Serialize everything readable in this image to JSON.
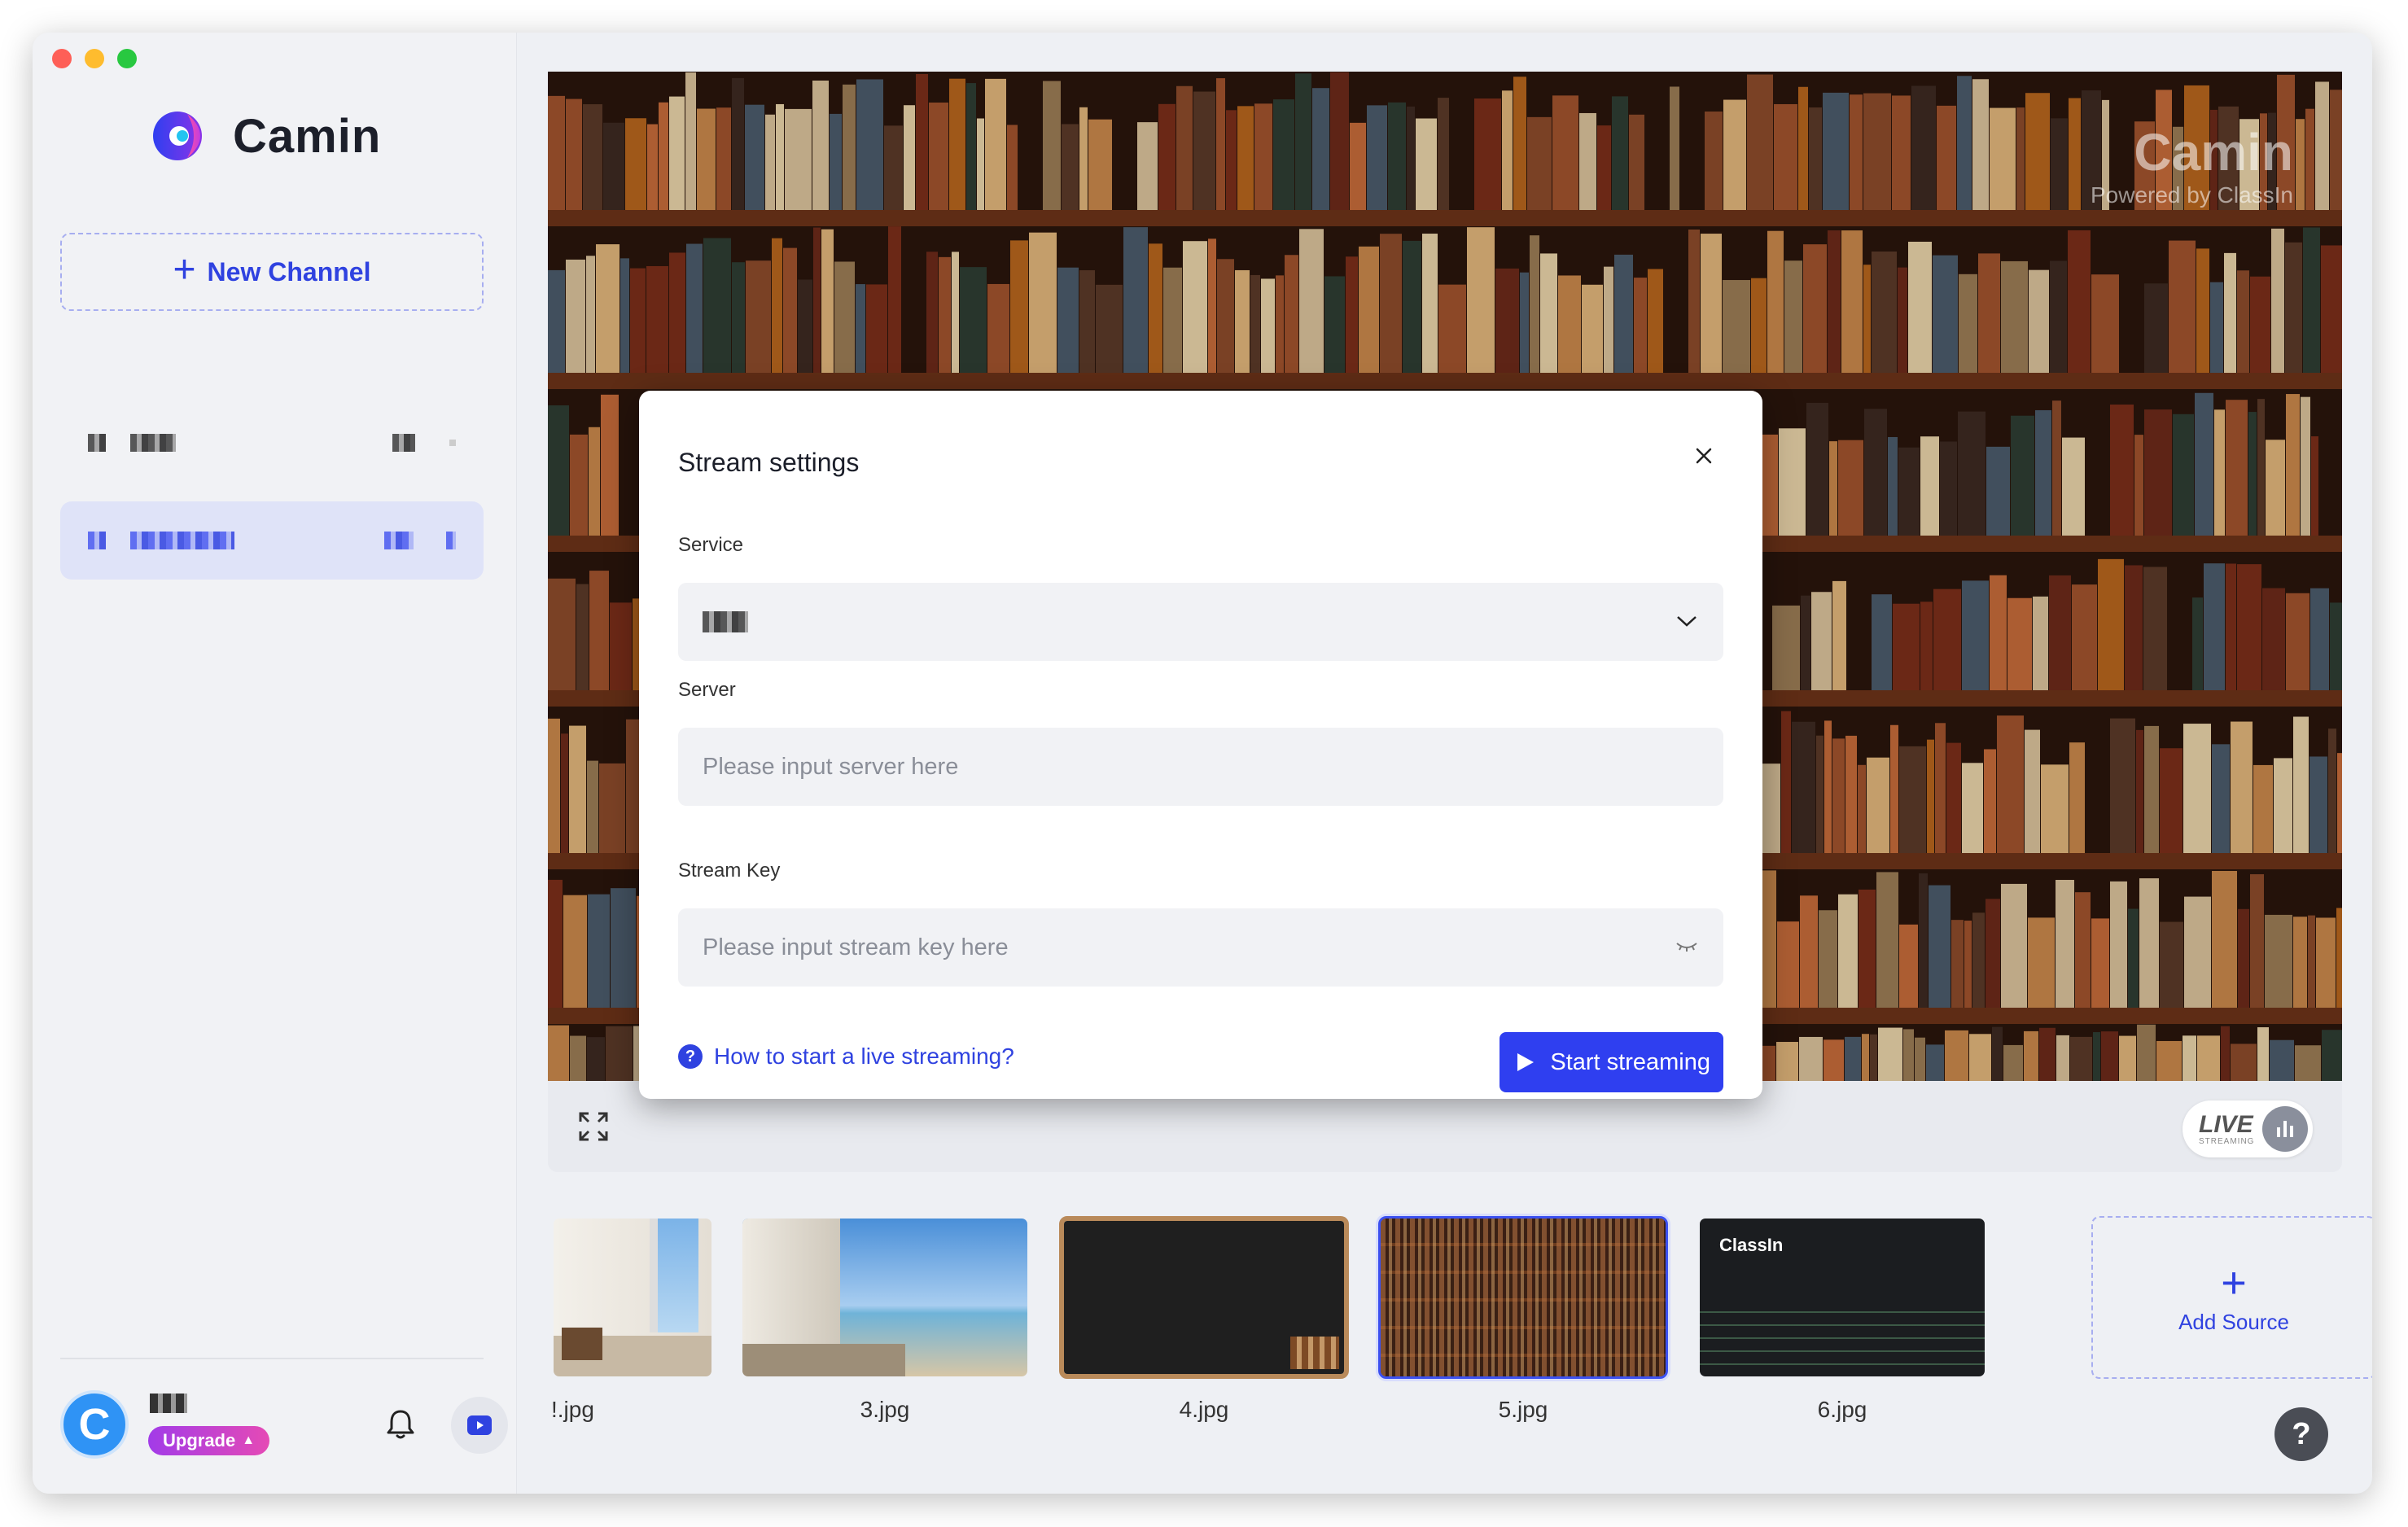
{
  "app": {
    "name": "Camin"
  },
  "sidebar": {
    "new_channel_label": "New Channel",
    "user": {
      "avatar_letter": "C",
      "upgrade_label": "Upgrade"
    }
  },
  "preview": {
    "watermark_title": "Camin",
    "watermark_subtitle": "Powered by ClassIn",
    "live_label": "LIVE",
    "live_sublabel": "STREAMING"
  },
  "modal": {
    "title": "Stream settings",
    "service_label": "Service",
    "server_label": "Server",
    "server_placeholder": "Please input server here",
    "stream_key_label": "Stream Key",
    "stream_key_placeholder": "Please input stream key here",
    "help_link": "How to start a live streaming?",
    "start_button": "Start streaming"
  },
  "sources": {
    "items": [
      {
        "label": "!.jpg"
      },
      {
        "label": "3.jpg"
      },
      {
        "label": "4.jpg"
      },
      {
        "label": "5.jpg",
        "selected": true
      },
      {
        "label": "6.jpg",
        "thumb_text": "ClassIn"
      }
    ],
    "add_label": "Add Source"
  },
  "help_button": "?",
  "colors": {
    "accent": "#2f42e0",
    "upgrade_start": "#a23be8",
    "upgrade_end": "#e54ab5"
  }
}
